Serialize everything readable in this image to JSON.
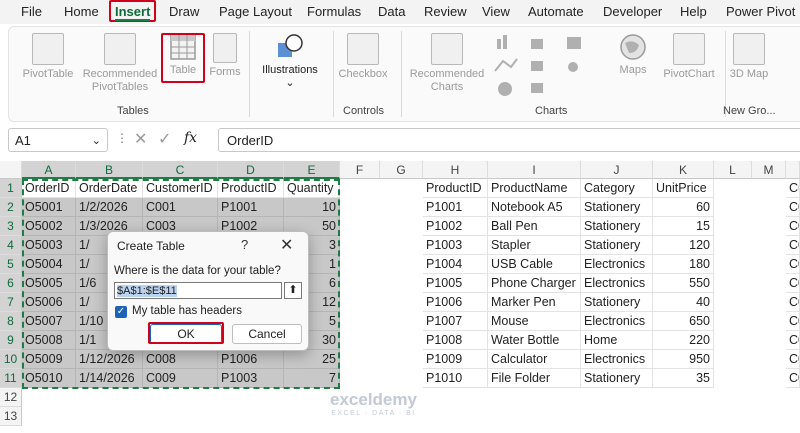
{
  "menu": [
    "File",
    "Home",
    "Insert",
    "Draw",
    "Page Layout",
    "Formulas",
    "Data",
    "Review",
    "View",
    "Automate",
    "Developer",
    "Help",
    "Power Pivot"
  ],
  "ribbon": {
    "tables_group": {
      "label": "Tables",
      "pivot_table": "PivotTable",
      "recommended_pivot": "Recommended PivotTables",
      "table": "Table",
      "forms": "Forms"
    },
    "illustrations": "Illustrations",
    "controls_group": {
      "label": "Controls",
      "checkbox": "Checkbox"
    },
    "charts_group": {
      "label": "Charts",
      "recommended_charts": "Recommended Charts",
      "maps": "Maps",
      "pivot_chart": "PivotChart"
    },
    "new_group": {
      "label": "New Gro...",
      "map3d": "3D Map"
    }
  },
  "formula_bar": {
    "name_box": "A1",
    "fx": "fx",
    "formula": "OrderID"
  },
  "columns": [
    "A",
    "B",
    "C",
    "D",
    "E",
    "F",
    "G",
    "H",
    "I",
    "J",
    "K",
    "L",
    "M"
  ],
  "rows": [
    "1",
    "2",
    "3",
    "4",
    "5",
    "6",
    "7",
    "8",
    "9",
    "10",
    "11",
    "12",
    "13"
  ],
  "orders": {
    "headers": [
      "OrderID",
      "OrderDate",
      "CustomerID",
      "ProductID",
      "Quantity"
    ],
    "rows": [
      [
        "O5001",
        "1/2/2026",
        "C001",
        "P1001",
        "10"
      ],
      [
        "O5002",
        "1/3/2026",
        "C003",
        "P1002",
        "50"
      ],
      [
        "O5003",
        "1/",
        "",
        "",
        "3"
      ],
      [
        "O5004",
        "1/",
        "",
        "",
        "1"
      ],
      [
        "O5005",
        "1/6",
        "",
        "",
        "6"
      ],
      [
        "O5006",
        "1/",
        "",
        "",
        "12"
      ],
      [
        "O5007",
        "1/10",
        "",
        "",
        "5"
      ],
      [
        "O5008",
        "1/1",
        "",
        "",
        "30"
      ],
      [
        "O5009",
        "1/12/2026",
        "C008",
        "P1006",
        "25"
      ],
      [
        "O5010",
        "1/14/2026",
        "C009",
        "P1003",
        "7"
      ]
    ]
  },
  "products": {
    "headers": [
      "ProductID",
      "ProductName",
      "Category",
      "UnitPrice"
    ],
    "rows": [
      [
        "P1001",
        "Notebook A5",
        "Stationery",
        "60"
      ],
      [
        "P1002",
        "Ball Pen",
        "Stationery",
        "15"
      ],
      [
        "P1003",
        "Stapler",
        "Stationery",
        "120"
      ],
      [
        "P1004",
        "USB Cable",
        "Electronics",
        "180"
      ],
      [
        "P1005",
        "Phone Charger",
        "Electronics",
        "550"
      ],
      [
        "P1006",
        "Marker Pen",
        "Stationery",
        "40"
      ],
      [
        "P1007",
        "Mouse",
        "Electronics",
        "650"
      ],
      [
        "P1008",
        "Water Bottle",
        "Home",
        "220"
      ],
      [
        "P1009",
        "Calculator",
        "Electronics",
        "950"
      ],
      [
        "P1010",
        "File Folder",
        "Stationery",
        "35"
      ]
    ]
  },
  "col_n": {
    "header": "Cu",
    "values": [
      "C0",
      "C0",
      "C0",
      "C0",
      "C0",
      "C0",
      "C0",
      "C0",
      "C0",
      "C0"
    ]
  },
  "dialog": {
    "title": "Create Table",
    "help": "?",
    "close": "✕",
    "prompt": "Where is the data for your table?",
    "range": "$A$1:$E$11",
    "headers_label": "My table has headers",
    "ok": "OK",
    "cancel": "Cancel"
  },
  "watermark": {
    "name": "exceldemy",
    "sub": "EXCEL · DATA · BI"
  }
}
